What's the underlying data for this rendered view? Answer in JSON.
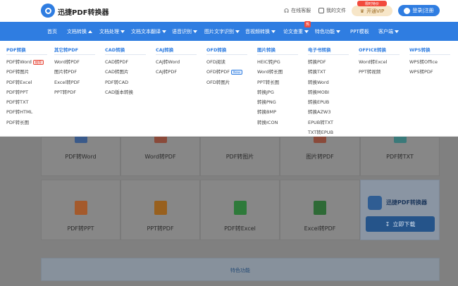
{
  "header": {
    "app_name": "迅捷PDF转换器",
    "online_service": "在线客服",
    "my_files": "我的文件",
    "vip_badge": "限时特价",
    "vip_label": "开通VIP",
    "login_label": "登录|注册"
  },
  "nav": {
    "items": [
      {
        "label": "首页",
        "caret": false
      },
      {
        "label": "文档转换",
        "caret": true,
        "active": true
      },
      {
        "label": "文档处理",
        "caret": true
      },
      {
        "label": "文档文本翻译",
        "caret": true
      },
      {
        "label": "语音识别",
        "caret": true
      },
      {
        "label": "图片文字识别",
        "caret": true
      },
      {
        "label": "音视频转换",
        "caret": true
      },
      {
        "label": "论文查重",
        "caret": true,
        "badge": "热"
      },
      {
        "label": "特色功能",
        "caret": true
      },
      {
        "label": "PPT模板",
        "caret": false
      },
      {
        "label": "客户端",
        "caret": true
      }
    ]
  },
  "dropdown": {
    "columns": [
      {
        "title": "PDF转换",
        "items": [
          {
            "label": "PDF转Word",
            "tag": "推荐"
          },
          {
            "label": "PDF转图片"
          },
          {
            "label": "PDF转Excel"
          },
          {
            "label": "PDF转PPT"
          },
          {
            "label": "PDF转TXT"
          },
          {
            "label": "PDF转HTML"
          },
          {
            "label": "PDF转长图"
          }
        ]
      },
      {
        "title": "其它转PDF",
        "items": [
          {
            "label": "Word转PDF"
          },
          {
            "label": "图片转PDF"
          },
          {
            "label": "Excel转PDF"
          },
          {
            "label": "PPT转PDF"
          }
        ]
      },
      {
        "title": "CAD转换",
        "items": [
          {
            "label": "CAD转PDF"
          },
          {
            "label": "CAD转图片"
          },
          {
            "label": "PDF转CAD"
          },
          {
            "label": "CAD版本转换"
          }
        ]
      },
      {
        "title": "CAJ转换",
        "items": [
          {
            "label": "CAJ转Word"
          },
          {
            "label": "CAJ转PDF"
          }
        ]
      },
      {
        "title": "OFD转换",
        "items": [
          {
            "label": "OFD阅读"
          },
          {
            "label": "OFD转PDF",
            "tag": "New"
          },
          {
            "label": "OFD转图片"
          }
        ]
      },
      {
        "title": "图片转换",
        "items": [
          {
            "label": "HEIC转JPG"
          },
          {
            "label": "Word转长图"
          },
          {
            "label": "PPT转长图"
          },
          {
            "label": "转换JPG"
          },
          {
            "label": "转换PNG"
          },
          {
            "label": "转换BMP"
          },
          {
            "label": "转换ICON"
          }
        ]
      },
      {
        "title": "电子书转换",
        "items": [
          {
            "label": "转换PDF"
          },
          {
            "label": "转换TXT"
          },
          {
            "label": "转换Word"
          },
          {
            "label": "转换MOBI"
          },
          {
            "label": "转换EPUB"
          },
          {
            "label": "转换AZW3"
          },
          {
            "label": "EPUB转TXT"
          },
          {
            "label": "TXT转EPUB"
          }
        ]
      },
      {
        "title": "OFFICE转换",
        "items": [
          {
            "label": "Word转Excel"
          },
          {
            "label": "PPT转视频"
          }
        ]
      },
      {
        "title": "WPS转换",
        "items": [
          {
            "label": "WPS转Office"
          },
          {
            "label": "WPS转PDF"
          }
        ]
      }
    ]
  },
  "cards": {
    "row1": [
      "PDF转Word",
      "Word转PDF",
      "PDF转图片",
      "图片转PDF",
      "PDF转TXT"
    ],
    "row2": [
      "PDF转PPT",
      "PPT转PDF",
      "PDF转Excel",
      "Excel转PDF"
    ]
  },
  "download": {
    "title": "迅捷PDF转换器",
    "button_label": "立即下载"
  },
  "feature_section": {
    "label": "特色功能"
  },
  "colors": {
    "brand_blue": "#2f7de1",
    "overlay_gray": "#808080"
  }
}
